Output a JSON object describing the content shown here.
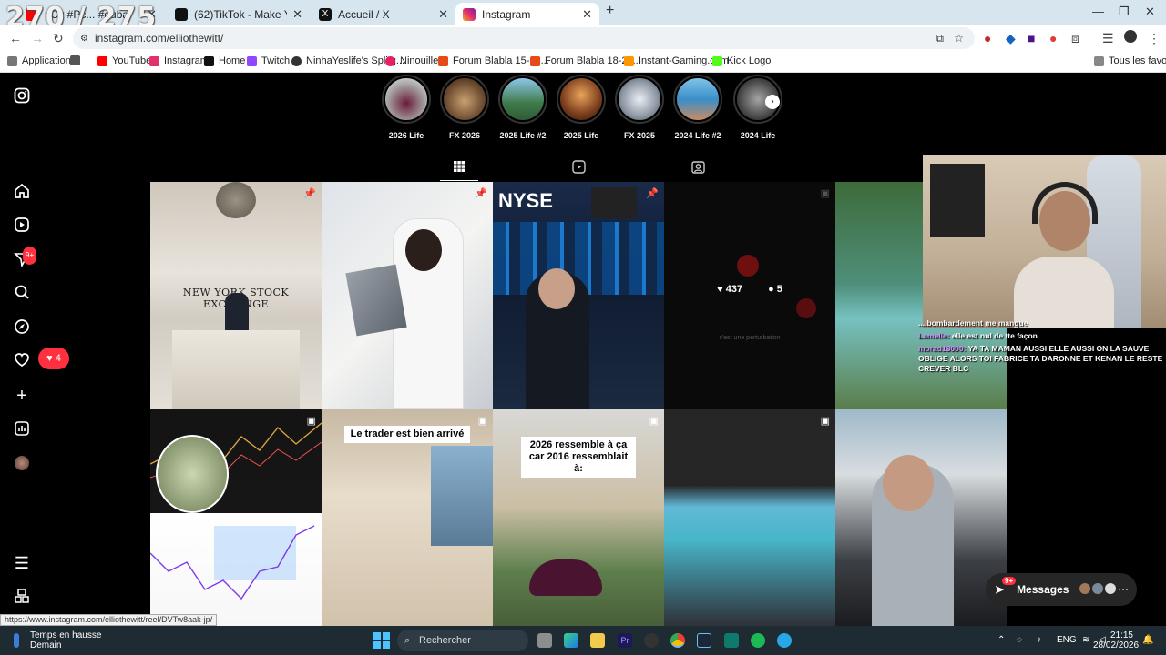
{
  "overlay_counter": "270 / 275",
  "tabs": [
    {
      "title": "pCv #Pc... #duba",
      "icon": "youtube-icon",
      "color": "#ff0000"
    },
    {
      "title": "(62)TikTok - Make Your Day",
      "icon": "tiktok-icon",
      "color": "#111111"
    },
    {
      "title": "Accueil / X",
      "icon": "x-icon",
      "color": "#111111"
    },
    {
      "title": "Instagram",
      "icon": "instagram-icon",
      "color": "#e1306c"
    }
  ],
  "address_bar": {
    "url": "instagram.com/elliothewitt/"
  },
  "bookmarks": [
    {
      "label": "Applications",
      "icon": "apps-grid-icon"
    },
    {
      "label": "",
      "icon": "google-apps-icon"
    },
    {
      "label": "YouTube",
      "icon": "youtube-icon"
    },
    {
      "label": "Instagram",
      "icon": "instagram-icon"
    },
    {
      "label": "Home",
      "icon": "x-icon"
    },
    {
      "label": "Twitch",
      "icon": "twitch-icon"
    },
    {
      "label": "NinhaYeslife's Splitg...",
      "icon": "splitgate-icon"
    },
    {
      "label": "Ninouille",
      "icon": "heart-icon"
    },
    {
      "label": "Forum Blabla 15-18...",
      "icon": "jvc-icon"
    },
    {
      "label": "Forum Blabla 18-25...",
      "icon": "jvc-icon"
    },
    {
      "label": "Instant-Gaming.com",
      "icon": "instant-gaming-icon"
    },
    {
      "label": "Kick Logo",
      "icon": "kick-icon"
    }
  ],
  "bookmarks_all": "Tous les favoris",
  "highlights": [
    {
      "label": "2026 Life"
    },
    {
      "label": "FX 2026"
    },
    {
      "label": "2025 Life #2"
    },
    {
      "label": "2025 Life"
    },
    {
      "label": "FX 2025"
    },
    {
      "label": "2024 Life #2"
    },
    {
      "label": "2024 Life"
    }
  ],
  "sidebar": {
    "notifications_badge": "9+",
    "activity_count": "4"
  },
  "posts": [
    {
      "caption": "",
      "overlay_text": "NEW YORK STOCK EXCHANGE",
      "pinned": true
    },
    {
      "caption": "",
      "overlay_text": "",
      "pinned": true
    },
    {
      "caption": "",
      "overlay_text": "NYSE",
      "pinned": true
    },
    {
      "caption": "",
      "overlay_text": "",
      "pinned": false,
      "likes": "437",
      "comments": "5",
      "faint": "c'est une perturbation"
    },
    {
      "caption": "",
      "overlay_text": "",
      "pinned": false
    },
    {
      "caption": "",
      "overlay_text": "",
      "pinned": false
    },
    {
      "caption": "Le trader est bien arrivé",
      "overlay_text": "",
      "pinned": false
    },
    {
      "caption": "2026 ressemble à ça\ncar 2016 ressemblait à:",
      "overlay_text": "",
      "pinned": false
    },
    {
      "caption": "",
      "overlay_text": "",
      "pinned": false
    },
    {
      "caption": "",
      "overlay_text": "",
      "pinned": false
    }
  ],
  "stream_chat": [
    {
      "user": "",
      "text": "....bombardement me manque"
    },
    {
      "user": "Lamelle:",
      "text": "elle est nul de tte façon"
    },
    {
      "user": "morad13000:",
      "text": "YA TA MAMAN AUSSI ELLE AUSSI ON LA SAUVE OBLIGE ALORS TOI FABRICE TA DARONNE ET KENAN LE RESTE CREVER BLC"
    }
  ],
  "messages": {
    "label": "Messages",
    "badge": "9+"
  },
  "status_url": "https://www.instagram.com/elliothewitt/reel/DVTw8aak-jp/",
  "taskbar": {
    "weather_title": "Temps en hausse",
    "weather_sub": "Demain",
    "search": "Rechercher",
    "lang": "ENG",
    "time": "21:15",
    "date": "28/02/2026"
  }
}
